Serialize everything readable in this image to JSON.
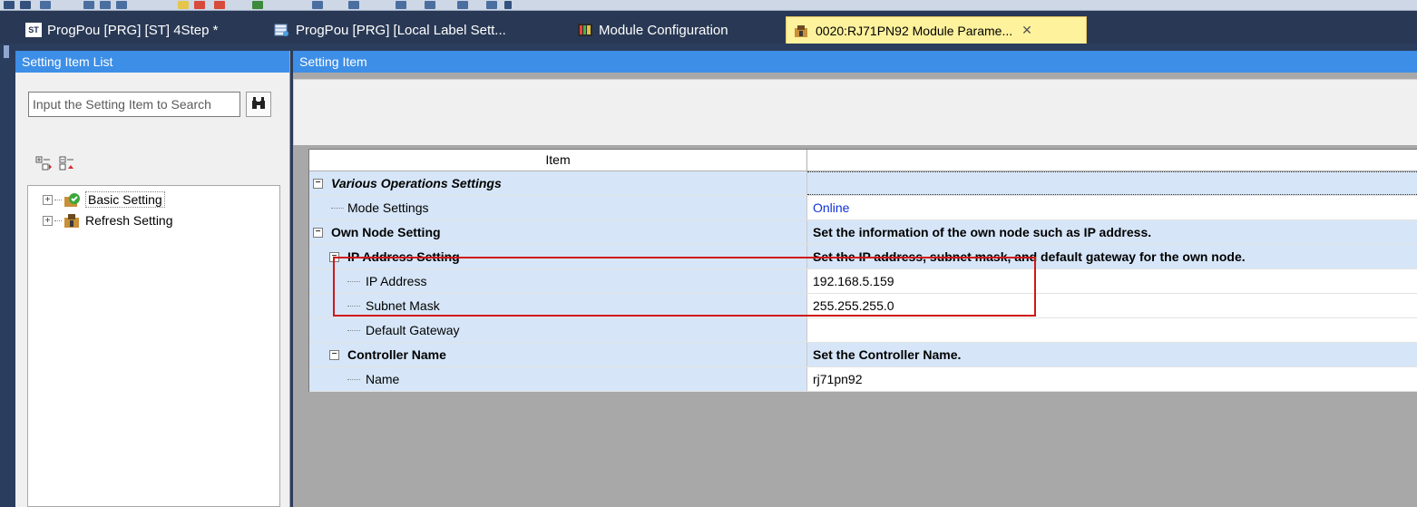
{
  "tabs": [
    {
      "label": "ProgPou [PRG] [ST] 4Step *",
      "icon": "st-program-icon"
    },
    {
      "label": "ProgPou [PRG] [Local Label Sett...",
      "icon": "label-table-icon"
    },
    {
      "label": "Module Configuration",
      "icon": "module-config-icon"
    },
    {
      "label": "0020:RJ71PN92 Module Parame...",
      "icon": "module-parameter-icon",
      "active": true
    }
  ],
  "tab_icon_text": "ST",
  "close_glyph": "✕",
  "list_panel": {
    "title": "Setting Item List",
    "search_placeholder": "Input the Setting Item to Search",
    "tree": [
      {
        "label": "Basic Setting",
        "icon": "basic-setting-icon"
      },
      {
        "label": "Refresh Setting",
        "icon": "refresh-setting-icon"
      }
    ]
  },
  "item_panel": {
    "title": "Setting Item",
    "column_header": "Item",
    "rows": [
      {
        "item": "Various Operations Settings",
        "value": "",
        "type": "section"
      },
      {
        "item": "Mode Settings",
        "value": "Online",
        "type": "leaf"
      },
      {
        "item": "Own Node Setting",
        "value": "Set the information of the own node such as IP address.",
        "type": "section"
      },
      {
        "item": "IP Address Setting",
        "value": "Set the IP address, subnet mask, and default gateway for the own node.",
        "type": "section"
      },
      {
        "item": "IP Address",
        "value": "192.168.5.159",
        "type": "leaf"
      },
      {
        "item": "Subnet Mask",
        "value": "255.255.255.0",
        "type": "leaf"
      },
      {
        "item": "Default Gateway",
        "value": "",
        "type": "leaf"
      },
      {
        "item": "Controller Name",
        "value": "Set the Controller Name.",
        "type": "section"
      },
      {
        "item": "Name",
        "value": "rj71pn92",
        "type": "leaf"
      }
    ]
  },
  "colors": {
    "panel_header": "#3d8ee6",
    "tab_bar": "#293955",
    "active_tab": "#fff29d",
    "grid_item_bg": "#d6e6f8",
    "highlight": "#d01818",
    "online_text": "#1030d8"
  }
}
